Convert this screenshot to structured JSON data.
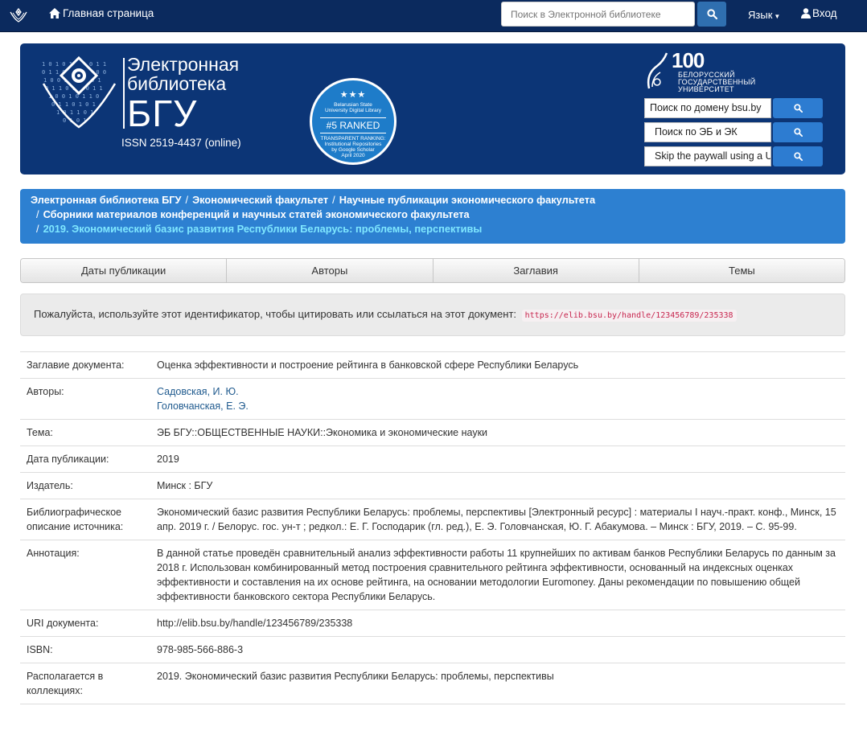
{
  "nav": {
    "home_label": "Главная страница",
    "search_placeholder": "Поиск в Электронной библиотеке",
    "language_label": "Язык",
    "login_label": "Вход"
  },
  "banner": {
    "title_line1": "Электронная",
    "title_line2": "библиотека",
    "title_line3": "БГУ",
    "issn": "ISSN 2519-4437 (online)",
    "badge": {
      "stars": "★★★",
      "line1": "Belarusian State",
      "line2": "University Digital Library",
      "rank": "#5 RANKED",
      "sub1": "TRANSPARENT RANKING:",
      "sub2": "Institutional Repositories",
      "sub3": "by Google Scholar",
      "sub4": "April 2020"
    },
    "university": {
      "number": "100",
      "line1": "БЕЛОРУССКИЙ",
      "line2": "ГОСУДАРСТВЕННЫЙ",
      "line3": "УНИВЕРСИТЕТ"
    },
    "side_searches": [
      "Поиск по домену bsu.by",
      "Поиск по ЭБ и ЭК",
      "Skip the paywall using a U"
    ]
  },
  "breadcrumb": {
    "item1": "Электронная библиотека БГУ",
    "item2": "Экономический факультет",
    "item3": "Научные публикации экономического факультета",
    "item4": "Сборники материалов конференций и научных статей экономического факультета",
    "current": "2019. Экономический базис развития Республики Беларусь: проблемы, перспективы"
  },
  "tabs": [
    "Даты публикации",
    "Авторы",
    "Заглавия",
    "Темы"
  ],
  "citation": {
    "text": "Пожалуйста, используйте этот идентификатор, чтобы цитировать или ссылаться на этот документ:",
    "url": "https://elib.bsu.by/handle/123456789/235338"
  },
  "metadata": {
    "title_label": "Заглавие документа:",
    "title_value": "Оценка эффективности и построение рейтинга в банковской сфере Республики Беларусь",
    "authors_label": "Авторы:",
    "authors": [
      "Садовская, И. Ю.",
      "Головчанская, Е. Э."
    ],
    "subject_label": "Тема:",
    "subject_value": "ЭБ БГУ::ОБЩЕСТВЕННЫЕ НАУКИ::Экономика и экономические науки",
    "date_label": "Дата публикации:",
    "date_value": "2019",
    "publisher_label": "Издатель:",
    "publisher_value": "Минск : БГУ",
    "biblio_label": "Библиографическое описание источника:",
    "biblio_value": "Экономический базис развития Республики Беларусь: проблемы, перспективы [Электронный ресурс] : материалы I науч.-практ. конф., Минск, 15 апр. 2019 г. / Белорус. гос. ун-т ; редкол.: Е. Г. Господарик (гл. ред.), Е. Э. Головчанская, Ю. Г. Абакумова. – Минск : БГУ, 2019. – С. 95-99.",
    "abstract_label": "Аннотация:",
    "abstract_value": "В данной статье проведён сравнительный анализ эффективности работы 11 крупнейших по активам банков Республики Беларусь по данным за 2018 г. Использован комбинированный метод построения сравнительного рейтинга эффективности, основанный на индексных оценках эффективности и составления на их основе рейтинга, на основании методологии Euromoney. Даны рекомендации по повышению общей эффективности банковского сектора Республики Беларусь.",
    "uri_label": "URI документа:",
    "uri_value": "http://elib.bsu.by/handle/123456789/235338",
    "isbn_label": "ISBN:",
    "isbn_value": "978-985-566-886-3",
    "collection_label": "Располагается в коллекциях:",
    "collection_value": "2019. Экономический базис развития Республики Беларусь: проблемы, перспективы"
  },
  "colors": {
    "navbar": "#0b2a5e",
    "banner": "#0c3576",
    "breadcrumb": "#2d80d1",
    "breadcrumb_current": "#7fe7ff",
    "link": "#1f5a8e"
  },
  "icons": [
    "bsu-crest-icon",
    "home-icon",
    "search-icon",
    "caret-down-icon",
    "user-icon"
  ]
}
